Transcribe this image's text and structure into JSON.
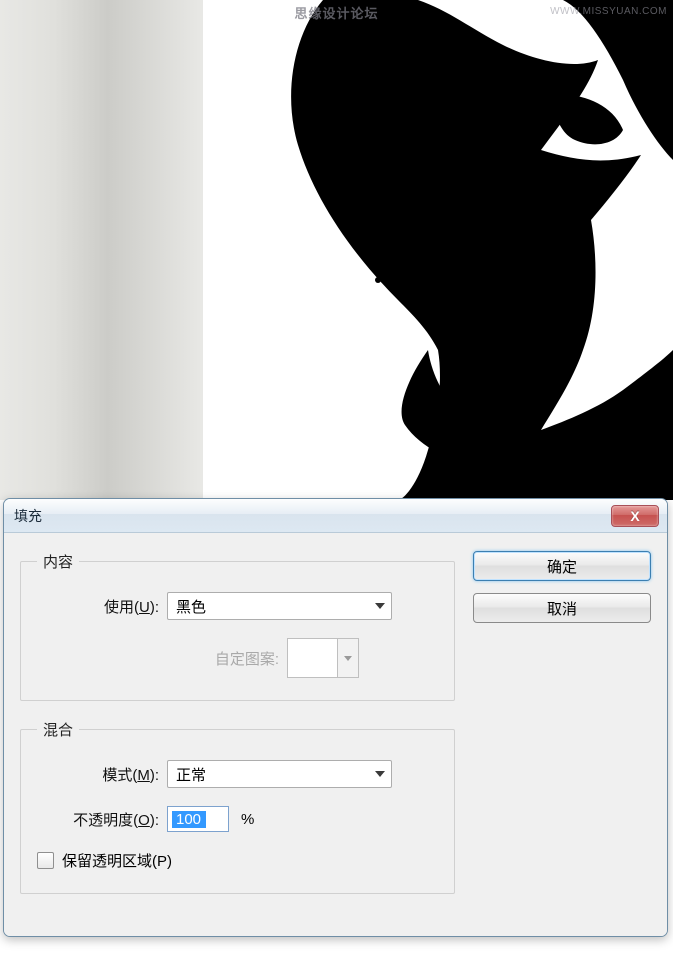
{
  "watermark_top": "思缘设计论坛",
  "watermark_corner": "WWW.MISSYUAN.COM",
  "dialog": {
    "title": "填充",
    "ok_label": "确定",
    "cancel_label": "取消",
    "content": {
      "legend": "内容",
      "use_label_pre": "使用(",
      "use_key": "U",
      "use_label_post": "):",
      "use_value": "黑色",
      "pattern_label": "自定图案:"
    },
    "blend": {
      "legend": "混合",
      "mode_label_pre": "模式(",
      "mode_key": "M",
      "mode_label_post": "):",
      "mode_value": "正常",
      "opacity_label_pre": "不透明度(",
      "opacity_key": "O",
      "opacity_label_post": "):",
      "opacity_value": "100",
      "opacity_unit": "%",
      "preserve_label_pre": "保留透明区域(",
      "preserve_key": "P",
      "preserve_label_post": ")"
    }
  }
}
